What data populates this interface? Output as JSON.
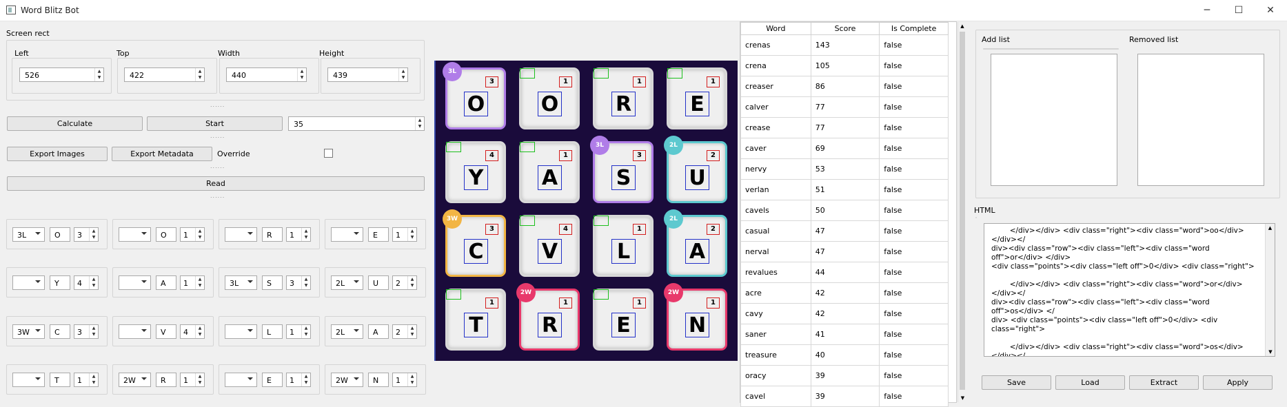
{
  "window": {
    "title": "Word Blitz Bot",
    "min": "─",
    "max": "☐",
    "close": "✕"
  },
  "screen_rect": {
    "title": "Screen rect",
    "left_label": "Left",
    "left": "526",
    "top_label": "Top",
    "top": "422",
    "width_label": "Width",
    "width": "440",
    "height_label": "Height",
    "height": "439"
  },
  "buttons": {
    "calculate": "Calculate",
    "start": "Start",
    "delay": "35",
    "export_images": "Export Images",
    "export_metadata": "Export Metadata",
    "override": "Override",
    "read": "Read",
    "save": "Save",
    "load": "Load",
    "extract": "Extract",
    "apply": "Apply"
  },
  "grid": [
    {
      "mult": "3L",
      "letter": "O",
      "pts": "3"
    },
    {
      "mult": "",
      "letter": "O",
      "pts": "1"
    },
    {
      "mult": "",
      "letter": "R",
      "pts": "1"
    },
    {
      "mult": "",
      "letter": "E",
      "pts": "1"
    },
    {
      "mult": "",
      "letter": "Y",
      "pts": "4"
    },
    {
      "mult": "",
      "letter": "A",
      "pts": "1"
    },
    {
      "mult": "3L",
      "letter": "S",
      "pts": "3"
    },
    {
      "mult": "2L",
      "letter": "U",
      "pts": "2"
    },
    {
      "mult": "3W",
      "letter": "C",
      "pts": "3"
    },
    {
      "mult": "",
      "letter": "V",
      "pts": "4"
    },
    {
      "mult": "",
      "letter": "L",
      "pts": "1"
    },
    {
      "mult": "2L",
      "letter": "A",
      "pts": "2"
    },
    {
      "mult": "",
      "letter": "T",
      "pts": "1"
    },
    {
      "mult": "2W",
      "letter": "R",
      "pts": "1"
    },
    {
      "mult": "",
      "letter": "E",
      "pts": "1"
    },
    {
      "mult": "2W",
      "letter": "N",
      "pts": "1"
    }
  ],
  "colors": {
    "3L": "#b07de8",
    "2L": "#5dc9cf",
    "3W": "#f2b544",
    "2W": "#e8396b"
  },
  "table": {
    "headers": [
      "Word",
      "Score",
      "Is Complete"
    ],
    "rows": [
      [
        "crenas",
        "143",
        "false"
      ],
      [
        "crena",
        "105",
        "false"
      ],
      [
        "creaser",
        "86",
        "false"
      ],
      [
        "calver",
        "77",
        "false"
      ],
      [
        "crease",
        "77",
        "false"
      ],
      [
        "caver",
        "69",
        "false"
      ],
      [
        "nervy",
        "53",
        "false"
      ],
      [
        "verlan",
        "51",
        "false"
      ],
      [
        "cavels",
        "50",
        "false"
      ],
      [
        "casual",
        "47",
        "false"
      ],
      [
        "nerval",
        "47",
        "false"
      ],
      [
        "revalues",
        "44",
        "false"
      ],
      [
        "acre",
        "42",
        "false"
      ],
      [
        "cavy",
        "42",
        "false"
      ],
      [
        "saner",
        "41",
        "false"
      ],
      [
        "treasure",
        "40",
        "false"
      ],
      [
        "oracy",
        "39",
        "false"
      ],
      [
        "cavel",
        "39",
        "false"
      ]
    ]
  },
  "lists": {
    "add": "Add list",
    "removed": "Removed list"
  },
  "html_label": "HTML",
  "html_text": "        </div></div> <div class=\"right\"><div class=\"word\">oo</div> </div></\ndiv><div class=\"row\"><div class=\"left\"><div class=\"word off\">or</div> </div>\n<div class=\"points\"><div class=\"left off\">0</div> <div class=\"right\">\n\n        </div></div> <div class=\"right\"><div class=\"word\">or</div> </div></\ndiv><div class=\"row\"><div class=\"left\"><div class=\"word off\">os</div> </\ndiv> <div class=\"points\"><div class=\"left off\">0</div> <div class=\"right\">\n\n        </div></div> <div class=\"right\"><div class=\"word\">os</div> </div></\ndiv><div class=\"row\"><div class=\"left\"><div class=\"word off\">oy</div> </\ndiv> <div class=\"points\"><div class=\"left off\">0</div> <div class=\"right\">\n\n        </div></div> <div class=\"right\"><div class=\"word\">oy</div> </div></\ndiv></div>"
}
